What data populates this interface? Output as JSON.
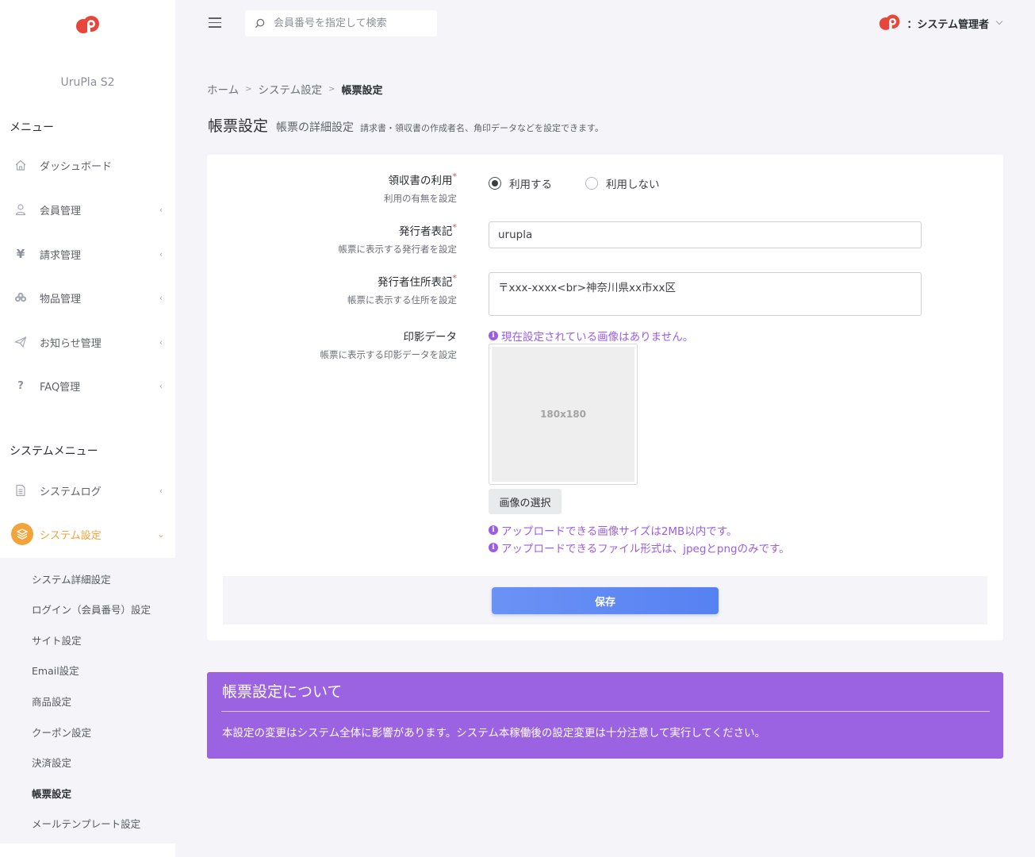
{
  "brand": {
    "name": "UruPla S2",
    "logo_icon": "urupla-logo-icon"
  },
  "sidebar": {
    "menu_heading": "メニュー",
    "menu_items": [
      {
        "label": "ダッシュボード",
        "icon": "home-icon"
      },
      {
        "label": "会員管理",
        "icon": "user-icon",
        "chevron": "‹"
      },
      {
        "label": "請求管理",
        "icon": "yen-icon",
        "chevron": "‹"
      },
      {
        "label": "物品管理",
        "icon": "boxes-icon",
        "chevron": "‹"
      },
      {
        "label": "お知らせ管理",
        "icon": "send-icon",
        "chevron": "‹"
      },
      {
        "label": "FAQ管理",
        "icon": "question-icon",
        "chevron": "‹"
      }
    ],
    "system_heading": "システムメニュー",
    "system_items": [
      {
        "label": "システムログ",
        "icon": "document-icon",
        "chevron": "‹"
      },
      {
        "label": "システム設定",
        "icon": "layers-icon",
        "chevron": "⌄",
        "active": true
      }
    ],
    "sub_items": [
      "システム詳細設定",
      "ログイン（会員番号）設定",
      "サイト設定",
      "Email設定",
      "商品設定",
      "クーポン設定",
      "決済設定",
      "帳票設定",
      "メールテンプレート設定"
    ],
    "accent_color": "#f2a33a"
  },
  "topbar": {
    "search_placeholder": "会員番号を指定して検索",
    "user_label": "：システム管理者"
  },
  "breadcrumb": {
    "home": "ホーム",
    "parent": "システム設定",
    "current": "帳票設定",
    "sep": ">"
  },
  "page": {
    "title": "帳票設定",
    "subtitle": "帳票の詳細設定",
    "description": "請求書・領収書の作成者名、角印データなどを設定できます。"
  },
  "form": {
    "receipt": {
      "label": "領収書の利用",
      "required": "*",
      "help": "利用の有無を設定",
      "options": [
        "利用する",
        "利用しない"
      ],
      "selected": "利用する"
    },
    "issuer": {
      "label": "発行者表記",
      "required": "*",
      "help": "帳票に表示する発行者を設定",
      "value": "urupla"
    },
    "address": {
      "label": "発行者住所表記",
      "required": "*",
      "help": "帳票に表示する住所を設定",
      "value": "〒xxx-xxxx<br>神奈川県xx市xx区"
    },
    "stamp": {
      "label": "印影データ",
      "help": "帳票に表示する印影データを設定",
      "current_info": "現在設定されている画像はありません。",
      "placeholder": "180x180",
      "select_button": "画像の選択",
      "size_note": "アップロードできる画像サイズは2MB以内です。",
      "format_note": "アップロードできるファイル形式は、jpegとpngのみです。"
    },
    "save_button": "保存",
    "info_color": "#9b5de5"
  },
  "notice": {
    "title": "帳票設定について",
    "body": "本設定の変更はシステム全体に影響があります。システム本稼働後の設定変更は十分注意して実行してください。",
    "color": "#9b63e2"
  }
}
